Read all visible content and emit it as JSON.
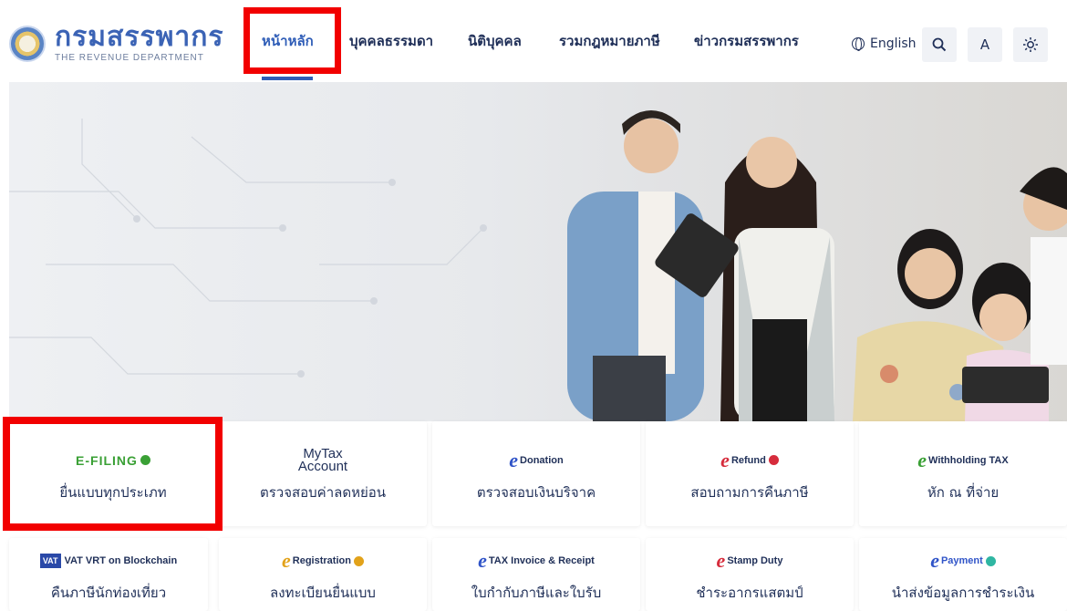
{
  "header": {
    "logo_th": "กรมสรรพากร",
    "logo_en": "THE REVENUE DEPARTMENT",
    "nav": [
      {
        "label": "หน้าหลัก",
        "active": true
      },
      {
        "label": "บุคคลธรรมดา",
        "active": false
      },
      {
        "label": "นิติบุคคล",
        "active": false
      },
      {
        "label": "รวมกฎหมายภาษี",
        "active": false
      },
      {
        "label": "ข่าวกรมสรรพากร",
        "active": false
      }
    ],
    "language": "English",
    "search_icon": "search-icon",
    "font_size_label": "A",
    "theme_icon": "sun-icon"
  },
  "services_row1": [
    {
      "logo": "E-FILING",
      "label": "ยื่นแบบทุกประเภท"
    },
    {
      "logo_line1": "MyTax",
      "logo_line2": "Account",
      "label": "ตรวจสอบค่าลดหย่อน"
    },
    {
      "logo": "Donation",
      "label": "ตรวจสอบเงินบริจาค"
    },
    {
      "logo": "Refund",
      "label": "สอบถามการคืนภาษี"
    },
    {
      "logo": "Withholding TAX",
      "label": "หัก ณ ที่จ่าย"
    }
  ],
  "services_row2": [
    {
      "logo": "VAT VRT on Blockchain",
      "label": "คืนภาษีนักท่องเที่ยว"
    },
    {
      "logo": "Registration",
      "label": "ลงทะเบียนยื่นแบบ"
    },
    {
      "logo": "TAX Invoice & Receipt",
      "label": "ใบกำกับภาษีและใบรับ"
    },
    {
      "logo": "Stamp Duty",
      "label": "ชำระอากรแสตมป์"
    },
    {
      "logo": "Payment",
      "label": "นำส่งข้อมูลการชำระเงิน"
    }
  ],
  "colors": {
    "brand_blue": "#2f5db7",
    "nav_text": "#1f2f58",
    "highlight_red": "#f20000"
  }
}
